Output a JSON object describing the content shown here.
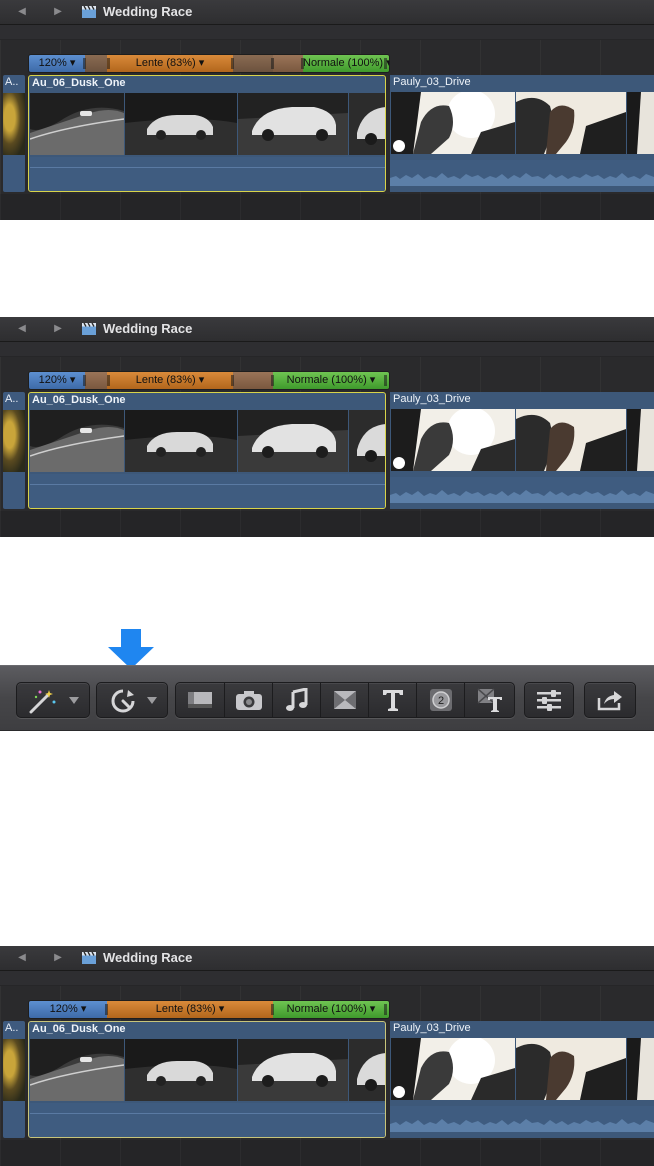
{
  "panels": [
    {
      "project_title": "Wedding Race",
      "speed_segments": [
        "120%",
        "Lente (83%)",
        "Normale (100%)"
      ],
      "clip_left_label": "A..",
      "clip_main_name": "Au_06_Dusk_One",
      "clip_right_name": "Pauly_03_Drive"
    },
    {
      "project_title": "Wedding Race",
      "speed_segments": [
        "120%",
        "Lente (83%)",
        "Normale (100%)"
      ],
      "clip_left_label": "A..",
      "clip_main_name": "Au_06_Dusk_One",
      "clip_right_name": "Pauly_03_Drive"
    },
    {
      "project_title": "Wedding Race",
      "speed_segments": [
        "120%",
        "Lente (83%)",
        "Normale (100%)"
      ],
      "clip_left_label": "A..",
      "clip_main_name": "Au_06_Dusk_One",
      "clip_right_name": "Pauly_03_Drive"
    }
  ],
  "toolbar": {
    "buttons": [
      "magic-wand-icon",
      "retime-icon",
      "video-browser-icon",
      "photo-browser-icon",
      "music-browser-icon",
      "transitions-browser-icon",
      "titles-browser-icon",
      "generators-browser-icon",
      "themes-browser-icon",
      "inspector-icon",
      "share-icon"
    ],
    "highlight_color": "#1f86f0"
  },
  "colors": {
    "speed_fast": "#4a7bc0",
    "speed_slow": "#c57728",
    "speed_normal": "#55b03c",
    "clip_selected_border": "#d8d44a",
    "clip_fill": "#3d5879"
  }
}
